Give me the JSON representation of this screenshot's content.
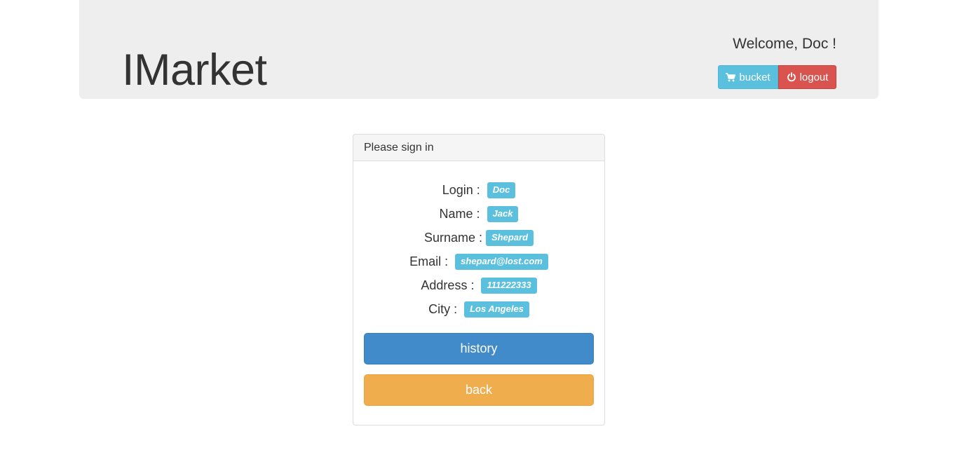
{
  "header": {
    "brand": "IMarket",
    "welcome": "Welcome, Doc !",
    "buttons": {
      "bucket_label": "bucket",
      "bucket_icon": "cart-icon",
      "logout_label": "logout",
      "logout_icon": "power-icon"
    }
  },
  "panel": {
    "heading": "Please sign in",
    "rows": [
      {
        "label": "Login : ",
        "value": "Doc"
      },
      {
        "label": "Name : ",
        "value": "Jack"
      },
      {
        "label": "Surname :",
        "value": "Shepard"
      },
      {
        "label": "Email : ",
        "value": "shepard@lost.com"
      },
      {
        "label": "Address : ",
        "value": "111222333"
      },
      {
        "label": "City : ",
        "value": "Los Angeles"
      }
    ],
    "history_label": "history",
    "back_label": "back"
  },
  "colors": {
    "info": "#5bc0de",
    "danger": "#d9534f",
    "primary": "#428bca",
    "warning": "#f0ad4e",
    "jumbotron": "#eeeeee"
  }
}
